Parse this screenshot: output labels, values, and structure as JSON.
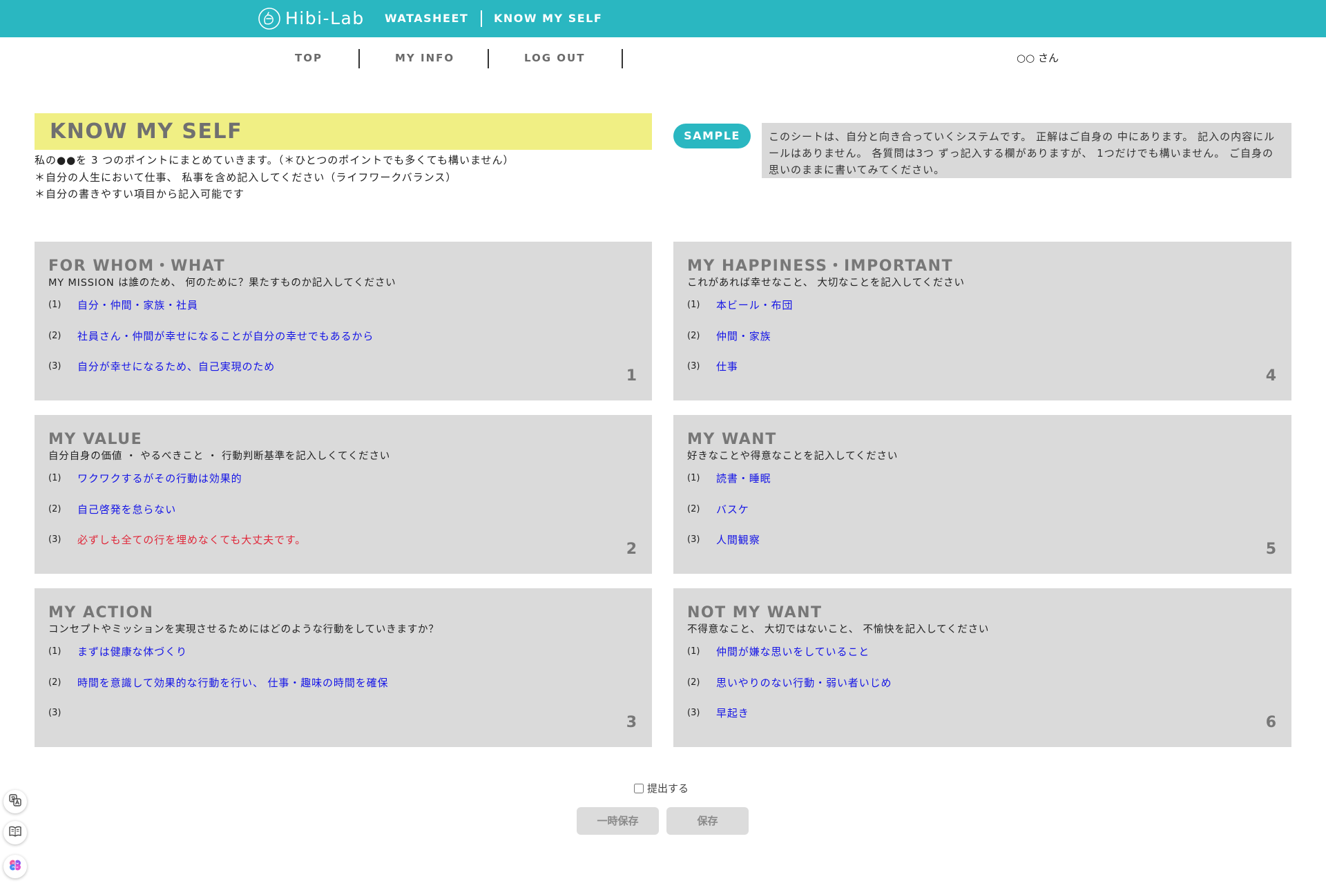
{
  "colors": {
    "header": "#2ab7c1",
    "accent": "#2ab7c1",
    "title_bg": "#f0ef84",
    "panel_bg": "#dadada",
    "desc_bg": "#d9d9d9",
    "heading": "#777777",
    "answer": "#1414e6",
    "note": "#e0283a",
    "button_bg": "#dcdcdc",
    "button_text": "#8a8a8a"
  },
  "header": {
    "logo_icon": "hibi-lab-logo-icon",
    "brand": "Hibi-Lab",
    "app": "WATASHEET",
    "page": "KNOW MY SELF"
  },
  "nav": {
    "items": [
      {
        "label": "TOP"
      },
      {
        "label": "MY INFO"
      },
      {
        "label": "LOG OUT"
      }
    ],
    "user": "○○ さん"
  },
  "intro": {
    "title": "KNOW MY SELF",
    "lines": [
      "私の●●を 3 つのポイントにまとめていきます。（＊ひとつのポイントでも多くても構いません）",
      "＊自分の人生において仕事、 私事を含め記入してください（ライフワークバランス）",
      "＊自分の書きやすい項目から記入可能です"
    ],
    "sample_button": "SAMPLE",
    "description": "このシートは、自分と向き合っていくシステムです。 正解はご自身の 中にあります。 記入の内容にルールはありません。 各質問は3つ ずっ記入する欄がありますが、 1つだけでも構いません。 ご自身の 思いのままに書いてみてください。"
  },
  "panels": [
    {
      "heading": "FOR WHOM・WHAT",
      "subtitle": "MY MISSION は誰のため、 何のために？果たすものか記入してください",
      "number": "1",
      "items": [
        {
          "marker": "(1)",
          "text": "自分・仲間・家族・社員"
        },
        {
          "marker": "(2)",
          "text": "社員さん・仲間が幸せになることが自分の幸せでもあるから"
        },
        {
          "marker": "(3)",
          "text": "自分が幸せになるため、自己実現のため"
        }
      ]
    },
    {
      "heading": "MY VALUE",
      "subtitle": "自分自身の価値 ・ やるべきこと ・ 行動判断基準を記入しくてください",
      "number": "2",
      "items": [
        {
          "marker": "(1)",
          "text": "ワクワクするがその行動は効果的"
        },
        {
          "marker": "(2)",
          "text": "自己啓発を怠らない"
        },
        {
          "marker": "(3)",
          "text": "必ずしも全ての行を埋めなくても大丈夫です。"
        }
      ]
    },
    {
      "heading": "MY ACTION",
      "subtitle": "コンセプトやミッションを実現させるためにはどのような行動をしていきますか？",
      "number": "3",
      "items": [
        {
          "marker": "(1)",
          "text": "まずは健康な体づくり"
        },
        {
          "marker": "(2)",
          "text": "時間を意識して効果的な行動を行い、 仕事・趣味の時間を確保"
        },
        {
          "marker": "(3)",
          "text": ""
        }
      ]
    },
    {
      "heading": "MY HAPPINESS・IMPORTANT",
      "subtitle": "これがあれば幸せなこと、 大切なことを記入してください",
      "number": "4",
      "items": [
        {
          "marker": "(1)",
          "text": "本ビール・布団"
        },
        {
          "marker": "(2)",
          "text": "仲間・家族"
        },
        {
          "marker": "(3)",
          "text": "仕事"
        }
      ]
    },
    {
      "heading": "MY WANT",
      "subtitle": "好きなことや得意なことを記入してください",
      "number": "5",
      "items": [
        {
          "marker": "(1)",
          "text": "読書・睡眠"
        },
        {
          "marker": "(2)",
          "text": "バスケ"
        },
        {
          "marker": "(3)",
          "text": "人間観察"
        }
      ]
    },
    {
      "heading": "NOT MY WANT",
      "subtitle": "不得意なこと、 大切ではないこと、 不愉快を記入してください",
      "number": "6",
      "items": [
        {
          "marker": "(1)",
          "text": "仲間が嫌な思いをしていること"
        },
        {
          "marker": "(2)",
          "text": "思いやりのない行動・弱い者いじめ"
        },
        {
          "marker": "(3)",
          "text": "早起き"
        }
      ]
    }
  ],
  "footer": {
    "submit_label": "提出する",
    "submit_checked": false,
    "temp_save": "一時保存",
    "save": "保存"
  },
  "side_tools": [
    {
      "icon": "translate-icon"
    },
    {
      "icon": "reader-icon"
    },
    {
      "icon": "brain-icon"
    }
  ]
}
